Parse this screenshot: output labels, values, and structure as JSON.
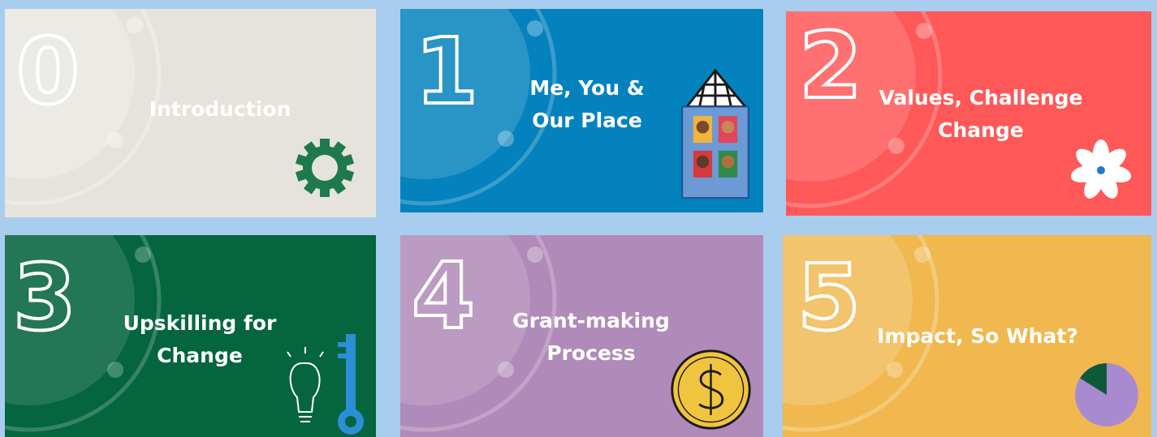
{
  "cards": [
    {
      "number": "0",
      "title_lines": [
        "Introduction"
      ],
      "color": "#e6e3dc",
      "illustration": "gear-icon"
    },
    {
      "number": "1",
      "title_lines": [
        "Me, You &",
        "Our Place"
      ],
      "color": "#0482bd",
      "illustration": "house-icon"
    },
    {
      "number": "2",
      "title_lines": [
        "Values, Challenge",
        "Change"
      ],
      "color": "#ff5858",
      "illustration": "flower-icon"
    },
    {
      "number": "3",
      "title_lines": [
        "Upskilling for",
        "Change"
      ],
      "color": "#05653f",
      "illustration": "lightbulb-key-icon"
    },
    {
      "number": "4",
      "title_lines": [
        "Grant-making",
        "Process"
      ],
      "color": "#b08ab8",
      "illustration": "dollar-coin-icon"
    },
    {
      "number": "5",
      "title_lines": [
        "Impact, So What?"
      ],
      "color": "#f0b84e",
      "illustration": "pie-chart-icon"
    }
  ]
}
